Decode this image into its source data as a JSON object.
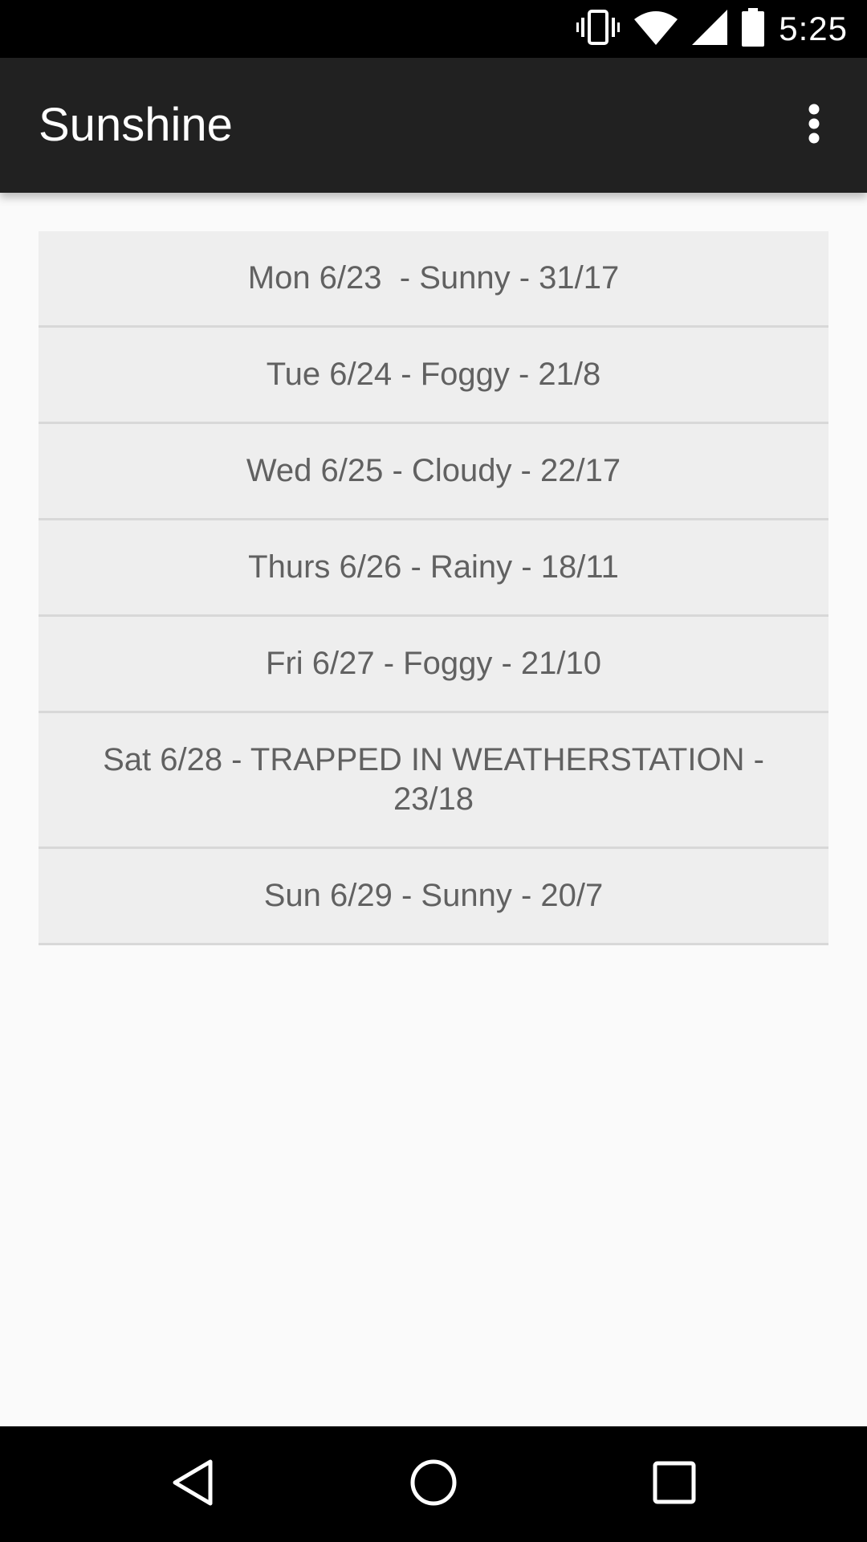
{
  "status_bar": {
    "time": "5:25",
    "icons": [
      "vibrate-icon",
      "wifi-icon",
      "cell-signal-icon",
      "battery-icon"
    ]
  },
  "app_bar": {
    "title": "Sunshine",
    "overflow_icon": "more-vert-icon"
  },
  "forecast": {
    "items": [
      "Mon 6/23  - Sunny - 31/17",
      "Tue 6/24 - Foggy - 21/8",
      "Wed 6/25 - Cloudy - 22/17",
      "Thurs 6/26 - Rainy - 18/11",
      "Fri 6/27 - Foggy - 21/10",
      "Sat 6/28 - TRAPPED IN WEATHERSTATION - 23/18",
      "Sun 6/29 - Sunny - 20/7"
    ]
  },
  "nav_bar": {
    "icons": [
      "back-icon",
      "home-icon",
      "recents-icon"
    ]
  },
  "colors": {
    "status_bar": "#000000",
    "app_bar": "#212121",
    "background": "#fafafa",
    "list_item": "#eeeeee",
    "list_text": "#616161",
    "divider": "#d8d8d8"
  }
}
